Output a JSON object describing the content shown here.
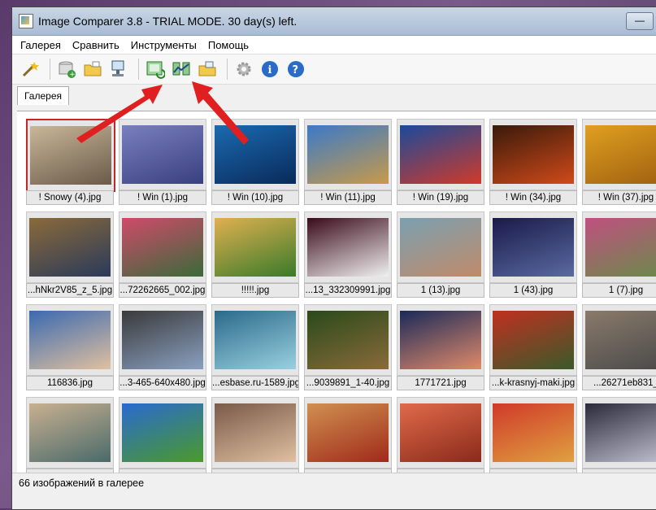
{
  "window": {
    "title": "Image Comparer 3.8 - TRIAL MODE. 30 day(s) left."
  },
  "menu": [
    "Галерея",
    "Сравнить",
    "Инструменты",
    "Помощь"
  ],
  "toolbar": [
    {
      "name": "magic-wand-icon"
    },
    {
      "name": "add-gallery-icon"
    },
    {
      "name": "open-folder-icon"
    },
    {
      "name": "compare-folders-icon"
    },
    {
      "name": "compare-with-gallery-icon"
    },
    {
      "name": "compare-sets-icon"
    },
    {
      "name": "export-folder-icon"
    },
    {
      "name": "settings-icon"
    },
    {
      "name": "info-icon"
    },
    {
      "name": "help-icon"
    }
  ],
  "tab": "Галерея",
  "thumbnails": [
    {
      "caption": "! Snowy (4).jpg",
      "selected": true
    },
    {
      "caption": "! Win (1).jpg"
    },
    {
      "caption": "! Win (10).jpg"
    },
    {
      "caption": "! Win (11).jpg"
    },
    {
      "caption": "! Win (19).jpg"
    },
    {
      "caption": "! Win (34).jpg"
    },
    {
      "caption": "! Win (37).jpg"
    },
    {
      "caption": "...hNkr2V85_z_5.jpg"
    },
    {
      "caption": "...72262665_002.jpg"
    },
    {
      "caption": "!!!!!.jpg"
    },
    {
      "caption": "...13_332309991.jpg"
    },
    {
      "caption": "1 (13).jpg"
    },
    {
      "caption": "1 (43).jpg"
    },
    {
      "caption": "1 (7).jpg"
    },
    {
      "caption": "116836.jpg"
    },
    {
      "caption": "...3-465-640x480.jpg"
    },
    {
      "caption": "...esbase.ru-1589.jpg"
    },
    {
      "caption": "...9039891_1-40.jpg"
    },
    {
      "caption": "1771721.jpg"
    },
    {
      "caption": "...k-krasnyj-maki.jpg"
    },
    {
      "caption": "...26271eb831_"
    },
    {
      "caption": ""
    },
    {
      "caption": ""
    },
    {
      "caption": ""
    },
    {
      "caption": ""
    },
    {
      "caption": ""
    },
    {
      "caption": ""
    },
    {
      "caption": ""
    }
  ],
  "status": "66 изображений в галерее",
  "colors": {
    "arrow": "#e02020",
    "selection": "#c0282a"
  }
}
